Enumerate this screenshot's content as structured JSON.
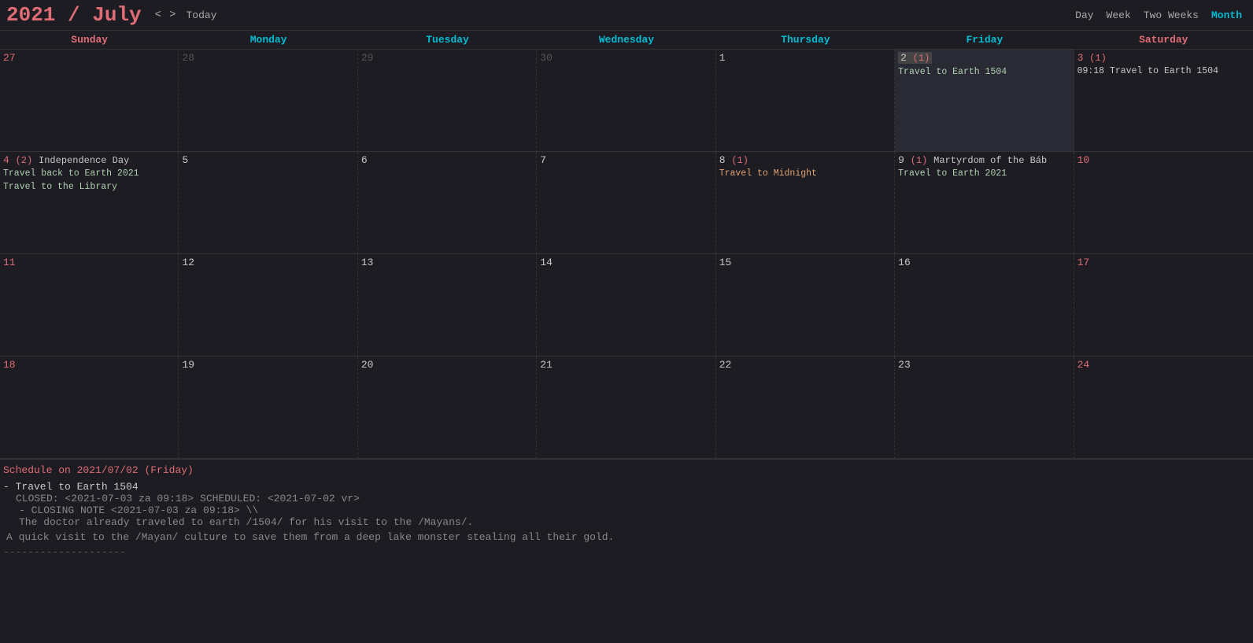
{
  "header": {
    "year": "2021",
    "separator": " / ",
    "month": "July",
    "nav_prev": "<",
    "nav_next": ">",
    "today_label": "Today",
    "views": [
      "Day",
      "Week",
      "Two Weeks",
      "Month"
    ],
    "active_view": "Month"
  },
  "day_headers": [
    {
      "label": "Sunday",
      "type": "sun"
    },
    {
      "label": "Monday",
      "type": "weekday"
    },
    {
      "label": "Tuesday",
      "type": "weekday"
    },
    {
      "label": "Wednesday",
      "type": "weekday"
    },
    {
      "label": "Thursday",
      "type": "weekday"
    },
    {
      "label": "Friday",
      "type": "weekday"
    },
    {
      "label": "Saturday",
      "type": "sat"
    }
  ],
  "weeks": [
    {
      "days": [
        {
          "date": "27",
          "out_of_month": true,
          "type": "sun",
          "events": []
        },
        {
          "date": "28",
          "out_of_month": true,
          "type": "weekday",
          "events": []
        },
        {
          "date": "29",
          "out_of_month": true,
          "type": "weekday",
          "events": []
        },
        {
          "date": "30",
          "out_of_month": true,
          "type": "weekday",
          "events": []
        },
        {
          "date": "1",
          "type": "weekday",
          "events": []
        },
        {
          "date": "2",
          "type": "weekday",
          "today": true,
          "count": "(1)",
          "events": [
            {
              "text": "Travel to Earth 1504",
              "style": "green"
            }
          ]
        },
        {
          "date": "3",
          "type": "sat",
          "count": "(1)",
          "events": [
            {
              "text": "09:18 Travel to Earth 1504",
              "style": "time"
            }
          ]
        }
      ]
    },
    {
      "days": [
        {
          "date": "4",
          "type": "sun",
          "count": "(2)",
          "holiday": "Independence Day",
          "events": [
            {
              "text": "Travel back to Earth 2021",
              "style": "green"
            },
            {
              "text": "Travel to the Library",
              "style": "green"
            }
          ]
        },
        {
          "date": "5",
          "type": "weekday",
          "events": []
        },
        {
          "date": "6",
          "type": "weekday",
          "events": []
        },
        {
          "date": "7",
          "type": "weekday",
          "events": []
        },
        {
          "date": "8",
          "type": "weekday",
          "count": "(1)",
          "events": [
            {
              "text": "Travel to Midnight",
              "style": "orange"
            }
          ]
        },
        {
          "date": "9",
          "type": "weekday",
          "count": "(1)",
          "holiday": "Martyrdom of the Báb",
          "events": [
            {
              "text": "Travel to Earth 2021",
              "style": "green"
            }
          ]
        },
        {
          "date": "10",
          "type": "sat",
          "events": []
        }
      ]
    },
    {
      "days": [
        {
          "date": "11",
          "type": "sun",
          "events": []
        },
        {
          "date": "12",
          "type": "weekday",
          "events": []
        },
        {
          "date": "13",
          "type": "weekday",
          "events": []
        },
        {
          "date": "14",
          "type": "weekday",
          "events": []
        },
        {
          "date": "15",
          "type": "weekday",
          "events": []
        },
        {
          "date": "16",
          "type": "weekday",
          "events": []
        },
        {
          "date": "17",
          "type": "sat",
          "events": []
        }
      ]
    },
    {
      "days": [
        {
          "date": "18",
          "type": "sun",
          "events": []
        },
        {
          "date": "19",
          "type": "weekday",
          "events": []
        },
        {
          "date": "20",
          "type": "weekday",
          "events": []
        },
        {
          "date": "21",
          "type": "weekday",
          "events": []
        },
        {
          "date": "22",
          "type": "weekday",
          "events": []
        },
        {
          "date": "23",
          "type": "weekday",
          "events": []
        },
        {
          "date": "24",
          "type": "sat",
          "events": []
        }
      ]
    }
  ],
  "schedule": {
    "title_prefix": "Schedule on ",
    "date": "2021/07/02",
    "day_label": "(Friday)",
    "items": [
      {
        "label": "- Travel to Earth 1504",
        "meta": "CLOSED: <2021-07-03 za 09:18> SCHEDULED: <2021-07-02 vr>",
        "note_label": "- CLOSING NOTE <2021-07-03 za 09:18> \\\\",
        "note_line1": "The doctor already traveled to earth /1504/ for his visit to the /Mayans/.",
        "description": "A quick visit to the /Mayan/ culture to save them from a deep lake monster stealing all their gold."
      }
    ],
    "divider": "--------------------"
  }
}
